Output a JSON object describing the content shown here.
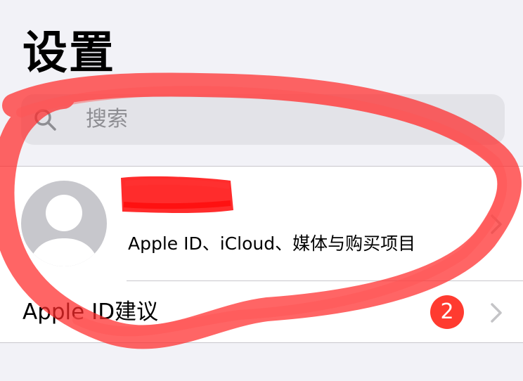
{
  "header": {
    "title": "设置"
  },
  "search": {
    "placeholder": "搜索"
  },
  "profile": {
    "subtitle": "Apple ID、iCloud、媒体与购买项目"
  },
  "apple_id_suggestions": {
    "label": "Apple ID建议",
    "badge_count": "2"
  },
  "colors": {
    "background": "#f2f2f7",
    "badge": "#ff3b30",
    "annotation": "#ff2a2a",
    "redaction": "#ff1a1a"
  }
}
